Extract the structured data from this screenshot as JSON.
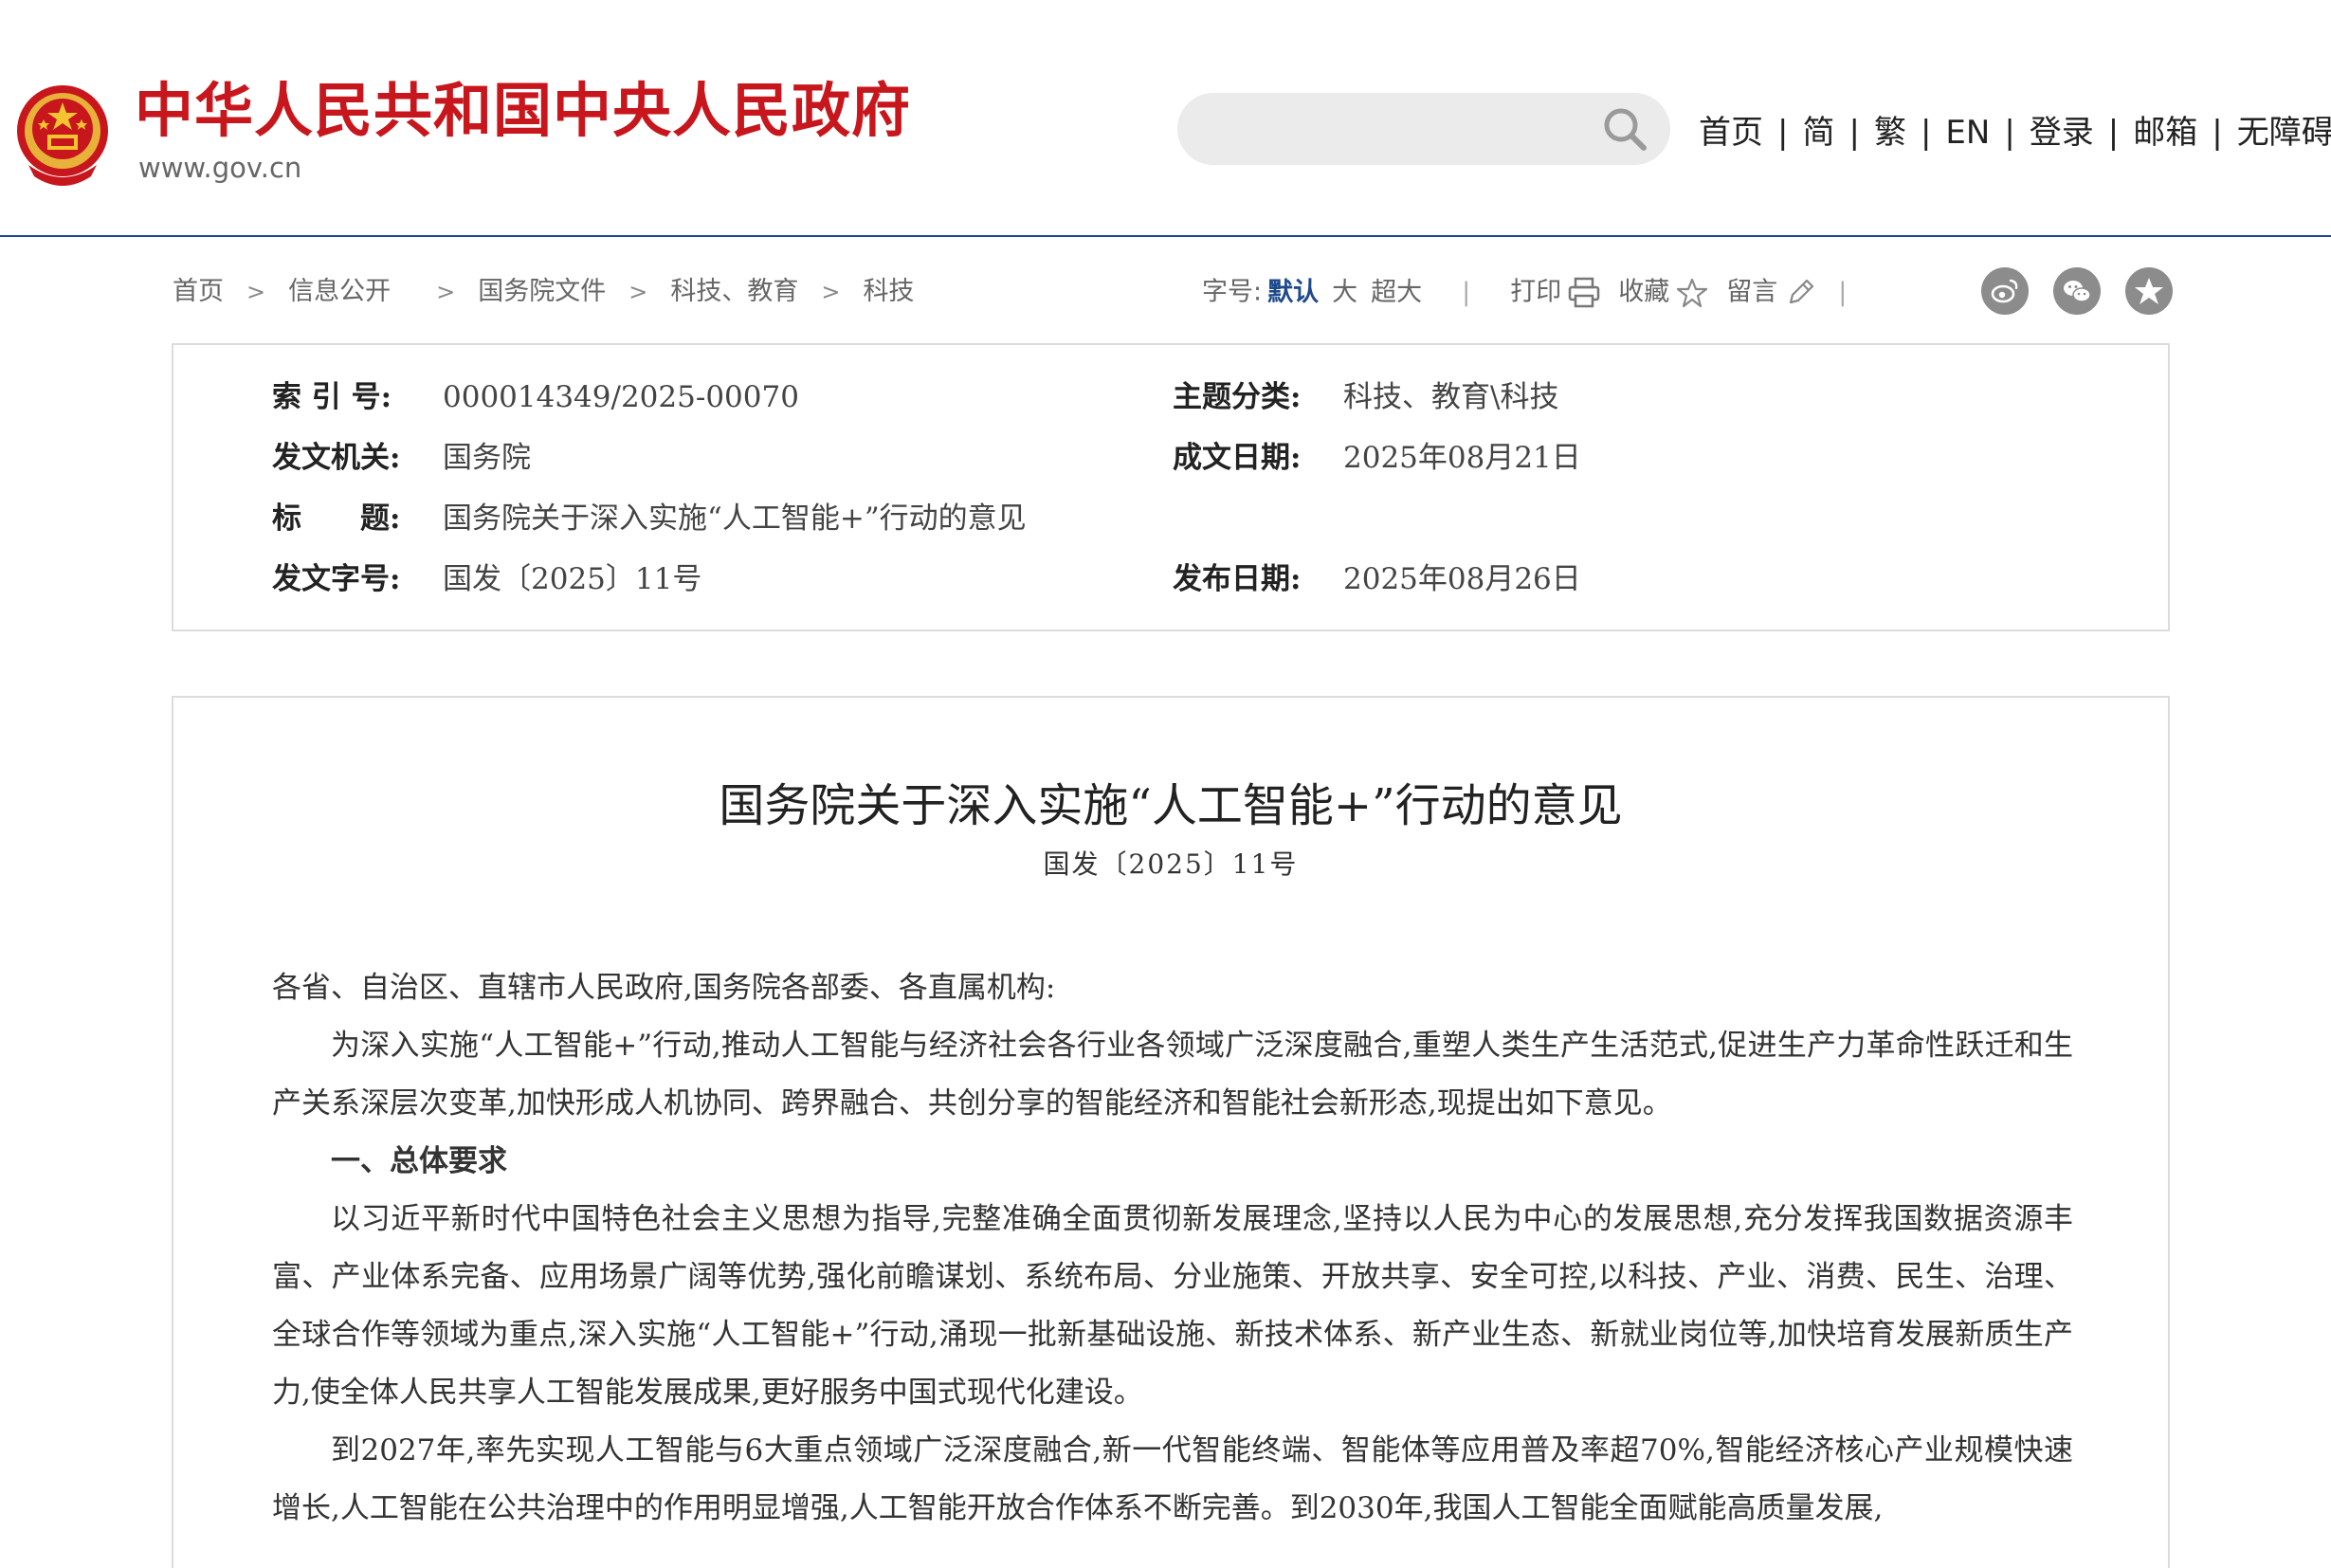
{
  "header": {
    "site_name": "中华人民共和国中央人民政府",
    "site_url": "www.gov.cn",
    "search": {
      "placeholder": ""
    },
    "nav": [
      {
        "label": "首页"
      },
      {
        "label": "简"
      },
      {
        "label": "繁"
      },
      {
        "label": "EN"
      },
      {
        "label": "登录"
      },
      {
        "label": "邮箱"
      },
      {
        "label": "无障碍"
      }
    ]
  },
  "breadcrumb": [
    "首页",
    "信息公开",
    "国务院文件",
    "科技、教育",
    "科技"
  ],
  "tools": {
    "font_size_label": "字号:",
    "font_sizes": [
      "默认",
      "大",
      "超大"
    ],
    "print": "打印",
    "favorite": "收藏",
    "comment": "留言",
    "share_icons": [
      "weibo-icon",
      "wechat-icon",
      "qzone-icon"
    ]
  },
  "meta": {
    "index_no": {
      "label": "索 引 号:",
      "value": "000014349/2025-00070"
    },
    "topic": {
      "label": "主题分类:",
      "value": "科技、教育\\科技"
    },
    "issuer": {
      "label": "发文机关:",
      "value": "国务院"
    },
    "written_date": {
      "label": "成文日期:",
      "value": "2025年08月21日"
    },
    "title": {
      "label": "标　　题:",
      "value": "国务院关于深入实施“人工智能+”行动的意见"
    },
    "doc_no": {
      "label": "发文字号:",
      "value": "国发〔2025〕11号"
    },
    "publish_date": {
      "label": "发布日期:",
      "value": "2025年08月26日"
    }
  },
  "article": {
    "title": "国务院关于深入实施“人工智能+”行动的意见",
    "doc_number": "国发〔2025〕11号",
    "salutation": "各省、自治区、直辖市人民政府,国务院各部委、各直属机构:",
    "intro": "为深入实施“人工智能+”行动,推动人工智能与经济社会各行业各领域广泛深度融合,重塑人类生产生活范式,促进生产力革命性跃迁和生产关系深层次变革,加快形成人机协同、跨界融合、共创分享的智能经济和智能社会新形态,现提出如下意见。",
    "section1_heading": "一、总体要求",
    "para1": "以习近平新时代中国特色社会主义思想为指导,完整准确全面贯彻新发展理念,坚持以人民为中心的发展思想,充分发挥我国数据资源丰富、产业体系完备、应用场景广阔等优势,强化前瞻谋划、系统布局、分业施策、开放共享、安全可控,以科技、产业、消费、民生、治理、全球合作等领域为重点,深入实施“人工智能+”行动,涌现一批新基础设施、新技术体系、新产业生态、新就业岗位等,加快培育发展新质生产力,使全体人民共享人工智能发展成果,更好服务中国式现代化建设。",
    "para2": "到2027年,率先实现人工智能与6大重点领域广泛深度融合,新一代智能终端、智能体等应用普及率超70%,智能经济核心产业规模快速增长,人工智能在公共治理中的作用明显增强,人工智能开放合作体系不断完善。到2030年,我国人工智能全面赋能高质量发展,"
  },
  "colors": {
    "brand_red": "#c8161d",
    "accent_blue": "#1e4a8c",
    "border_gray": "#dcdcdc",
    "share_icon_gray": "#8c8c8c"
  }
}
